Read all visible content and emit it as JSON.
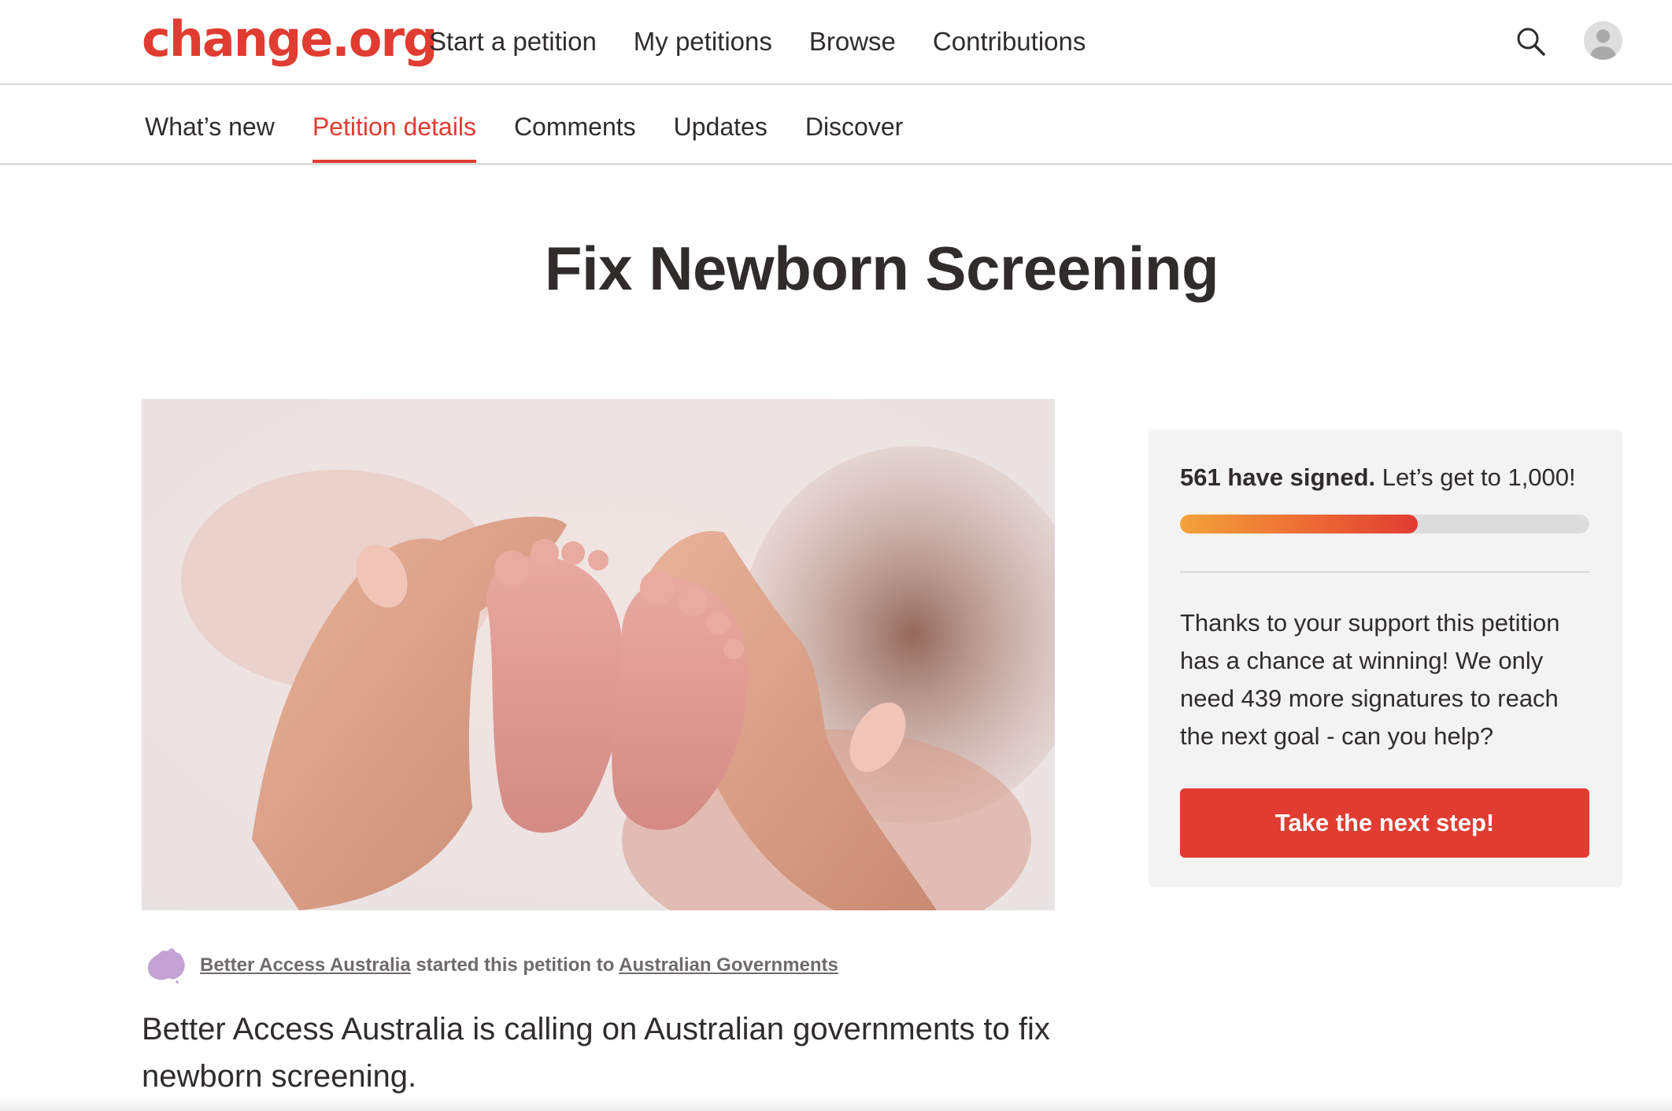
{
  "brand": {
    "logo_text": "change.org",
    "accent_color": "#e03c31"
  },
  "main_nav": {
    "items": [
      "Start a petition",
      "My petitions",
      "Browse",
      "Contributions"
    ],
    "search_icon": "search-icon",
    "avatar_icon": "user-avatar-icon"
  },
  "sub_nav": {
    "tabs": [
      {
        "label": "What’s new",
        "active": false
      },
      {
        "label": "Petition details",
        "active": true
      },
      {
        "label": "Comments",
        "active": false
      },
      {
        "label": "Updates",
        "active": false
      },
      {
        "label": "Discover",
        "active": false
      }
    ]
  },
  "petition": {
    "title": "Fix Newborn Screening",
    "image_description": "baby-feet-in-hands-photo",
    "starter": {
      "icon": "australia-map-icon",
      "organization": "Better Access Australia",
      "middle_text": "started this petition to",
      "target": "Australian Governments"
    },
    "body_first_paragraph": "Better Access Australia is calling on Australian governments to fix newborn screening."
  },
  "signature_card": {
    "signed_bold": "561 have signed.",
    "goal_text": "Let’s get to 1,000!",
    "signed_count": 561,
    "goal_count": 1000,
    "progress_fraction": 0.58,
    "message": "Thanks to your support this petition has a chance at winning! We only need 439 more signatures to reach the next goal - can you help?",
    "cta_label": "Take the next step!"
  }
}
